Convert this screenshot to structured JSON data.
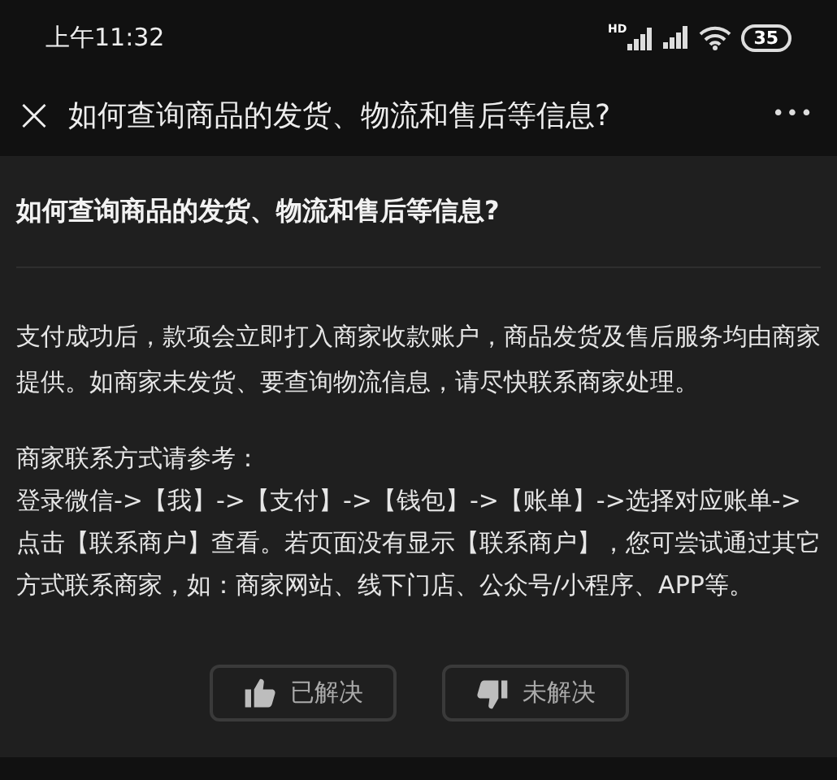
{
  "status_bar": {
    "time": "上午11:32",
    "network_label": "HD",
    "battery": "35"
  },
  "nav_bar": {
    "close": "×",
    "title": "如何查询商品的发货、物流和售后等信息?",
    "more": "•••"
  },
  "article": {
    "heading": "如何查询商品的发货、物流和售后等信息?",
    "paragraphs": [
      "支付成功后，款项会立即打入商家收款账户，商品发货及售后服务均由商家提供。如商家未发货、要查询物流信息，请尽快联系商家处理。",
      "商家联系方式请参考：",
      "登录微信->【我】->【支付】->【钱包】->【账单】->选择对应账单->点击【联系商户】查看。若页面没有显示【联系商户】，您可尝试通过其它方式联系商家，如：商家网站、线下门店、公众号/小程序、APP等。"
    ]
  },
  "feedback": [
    {
      "kind": "up",
      "label": "已解决"
    },
    {
      "kind": "down",
      "label": "未解决"
    }
  ]
}
